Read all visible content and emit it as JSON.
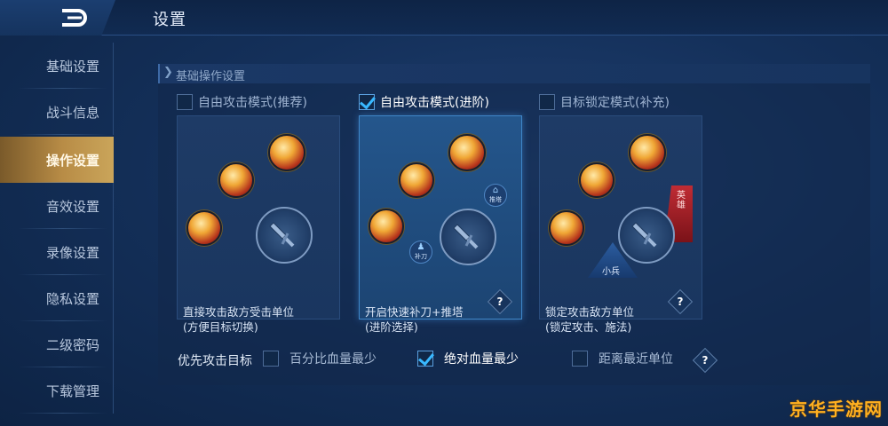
{
  "header": {
    "title": "设置"
  },
  "sidebar": {
    "items": [
      {
        "label": "基础设置"
      },
      {
        "label": "战斗信息"
      },
      {
        "label": "操作设置"
      },
      {
        "label": "音效设置"
      },
      {
        "label": "录像设置"
      },
      {
        "label": "隐私设置"
      },
      {
        "label": "二级密码"
      },
      {
        "label": "下载管理"
      }
    ],
    "active": "操作设置"
  },
  "section": {
    "title": "基础操作设置"
  },
  "modes": [
    {
      "title": "自由攻击模式(推荐)",
      "checked": false,
      "desc1": "直接攻击敌方受击单位",
      "desc2": "(方便目标切换)"
    },
    {
      "title": "自由攻击模式(进阶)",
      "checked": true,
      "desc1": "开启快速补刀+推塔",
      "desc2": "(进阶选择)",
      "mini_top": "推塔",
      "mini_bottom": "补刀"
    },
    {
      "title": "目标锁定模式(补充)",
      "checked": false,
      "desc1": "锁定攻击敌方单位",
      "desc2": "(锁定攻击、施法)",
      "hero_flag": "英雄",
      "minion_flag": "小兵"
    }
  ],
  "help_glyph": "?",
  "priority": {
    "label": "优先攻击目标",
    "options": [
      {
        "label": "百分比血量最少",
        "checked": false
      },
      {
        "label": "绝对血量最少",
        "checked": true
      },
      {
        "label": "距离最近单位",
        "checked": false
      }
    ]
  },
  "watermark": "京华手游网",
  "icons": {
    "back": "back-arrow-icon",
    "check": "checkmark-icon",
    "help": "question-icon",
    "attack": "sword-icon"
  }
}
